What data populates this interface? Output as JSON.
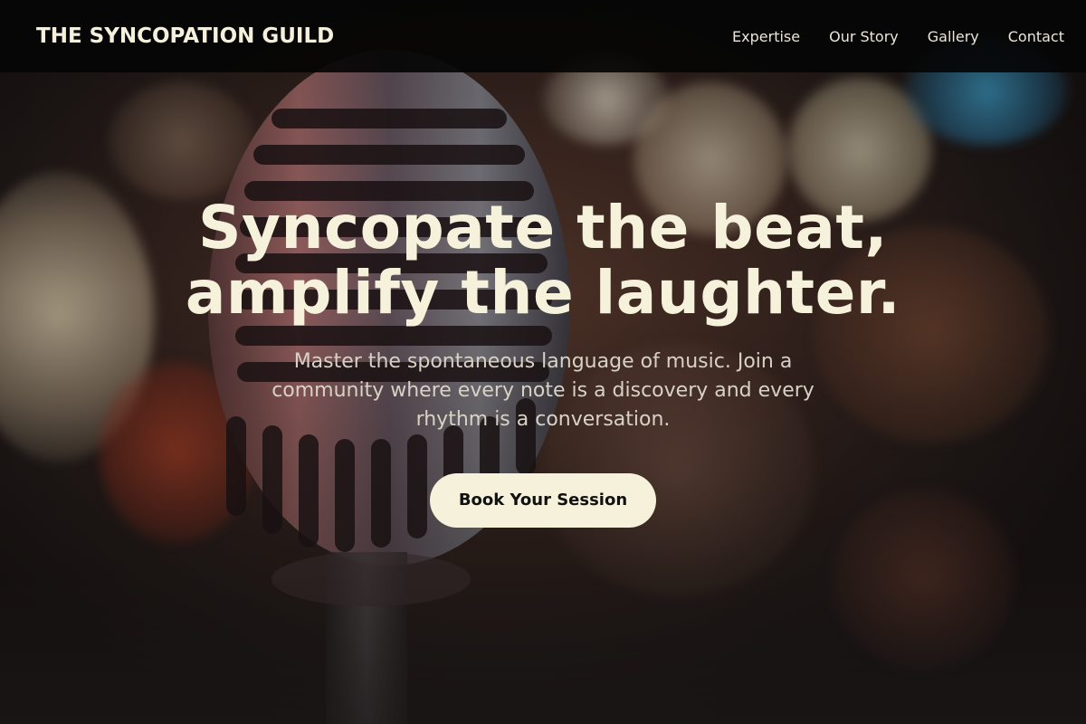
{
  "nav": {
    "brand": "THE SYNCOPATION GUILD",
    "links": [
      {
        "label": "Expertise"
      },
      {
        "label": "Our Story"
      },
      {
        "label": "Gallery"
      },
      {
        "label": "Contact"
      }
    ]
  },
  "hero": {
    "headline_line1": "Syncopate the beat,",
    "headline_line2": "amplify the laughter.",
    "subtext": "Master the spontaneous language of music. Join a community where every note is a discovery and every rhythm is a conversation.",
    "cta_label": "Book Your Session",
    "background_image": "vintage-microphone-bokeh"
  },
  "colors": {
    "nav_background": "#050505",
    "headline": "#f6f1da",
    "cta_background": "#f6f1da",
    "cta_text": "#111111"
  }
}
